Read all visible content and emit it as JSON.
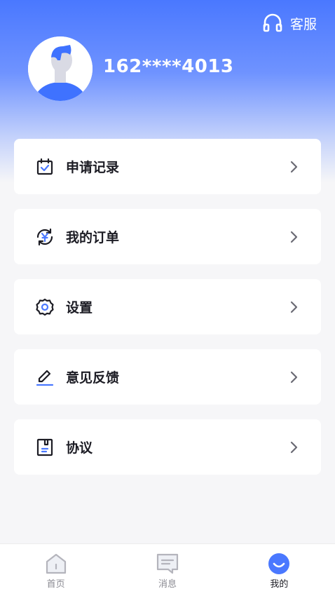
{
  "header": {
    "service_label": "客服",
    "phone": "162****4013"
  },
  "menu": {
    "items": [
      {
        "label": "申请记录",
        "icon": "calendar-check-icon"
      },
      {
        "label": "我的订单",
        "icon": "yuan-refresh-icon"
      },
      {
        "label": "设置",
        "icon": "gear-icon"
      },
      {
        "label": "意见反馈",
        "icon": "pencil-icon"
      },
      {
        "label": "协议",
        "icon": "document-icon"
      }
    ]
  },
  "tabbar": {
    "tabs": [
      {
        "label": "首页",
        "icon": "home-icon"
      },
      {
        "label": "消息",
        "icon": "message-icon"
      },
      {
        "label": "我的",
        "icon": "profile-smile-icon",
        "active": true
      }
    ]
  },
  "colors": {
    "primary": "#4a78ff",
    "text_dark": "#1c1c24",
    "text_muted": "#8a8a92"
  }
}
